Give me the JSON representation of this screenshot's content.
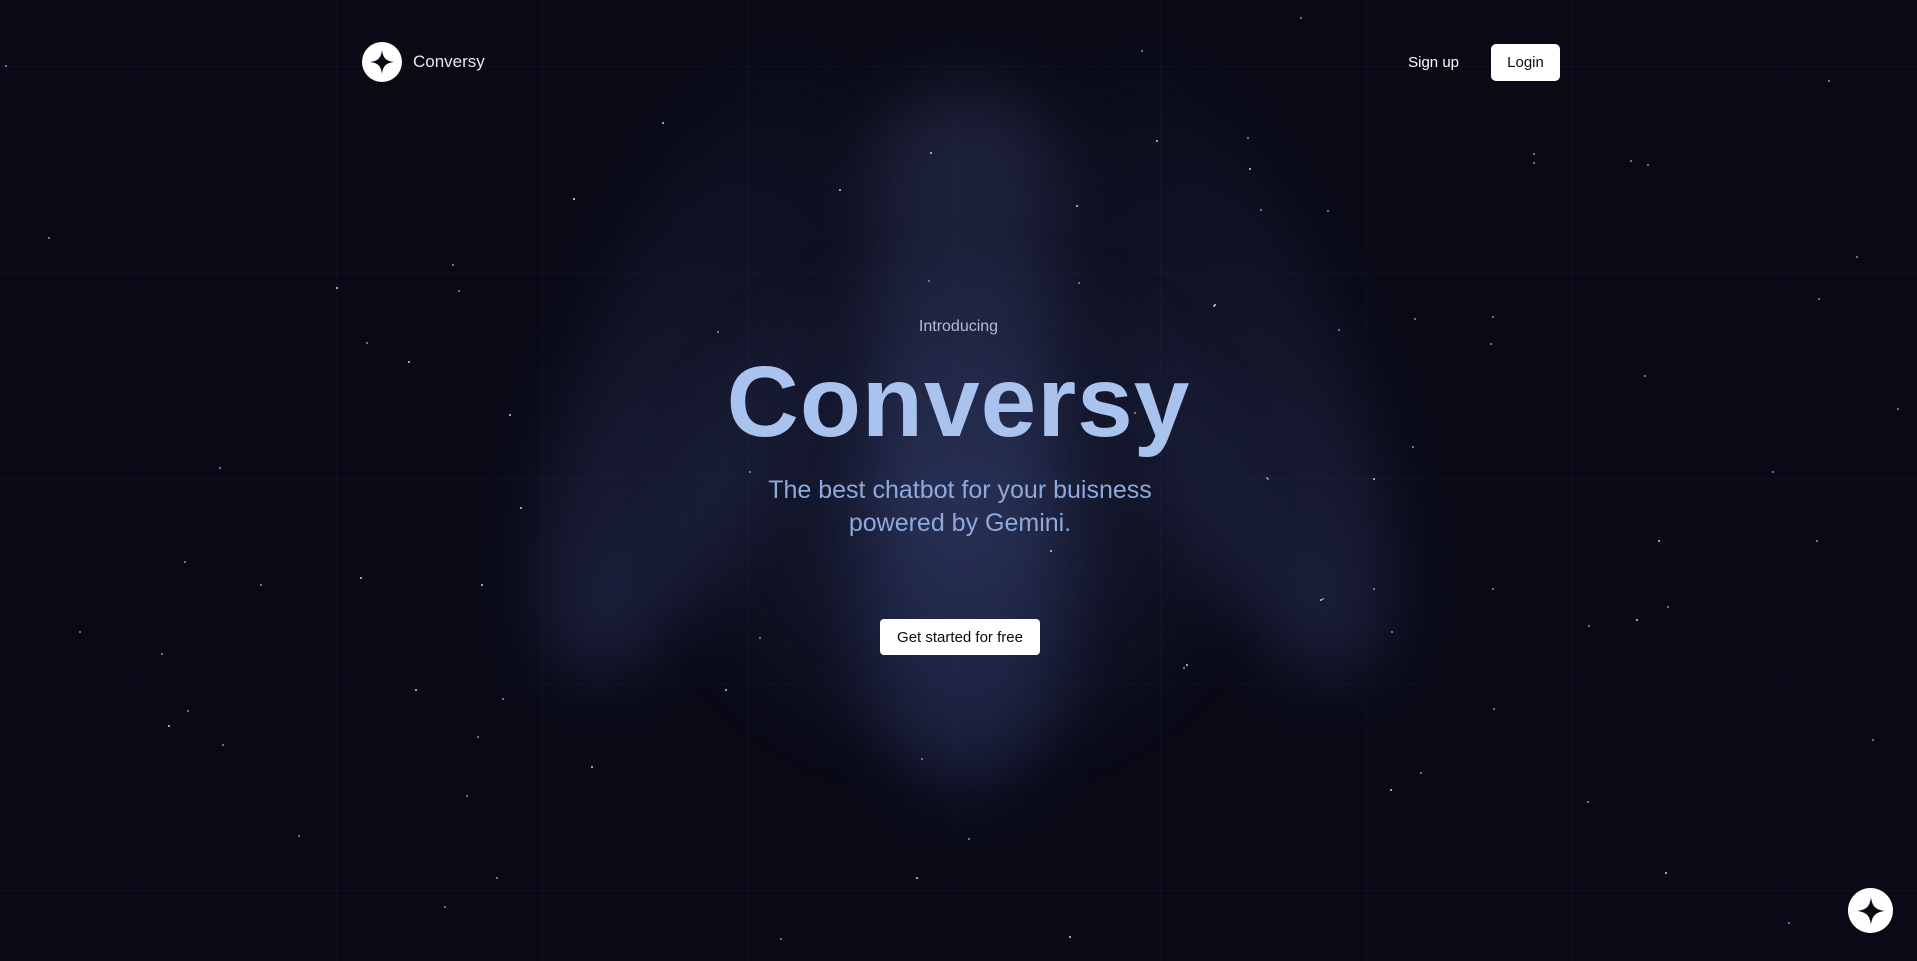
{
  "brand": {
    "name": "Conversy",
    "logo_icon": "sparkle-icon"
  },
  "nav": {
    "signup_label": "Sign up",
    "login_label": "Login"
  },
  "hero": {
    "eyebrow": "Introducing",
    "title": "Conversy",
    "subtitle": "The best chatbot for your buisness powered by Gemini.",
    "cta_label": "Get started for free"
  },
  "chat_widget": {
    "icon": "sparkle-icon"
  },
  "colors": {
    "background": "#0a0a17",
    "title": "#a9c2ee",
    "subtitle": "#8ea9da",
    "button_bg": "#ffffff"
  }
}
